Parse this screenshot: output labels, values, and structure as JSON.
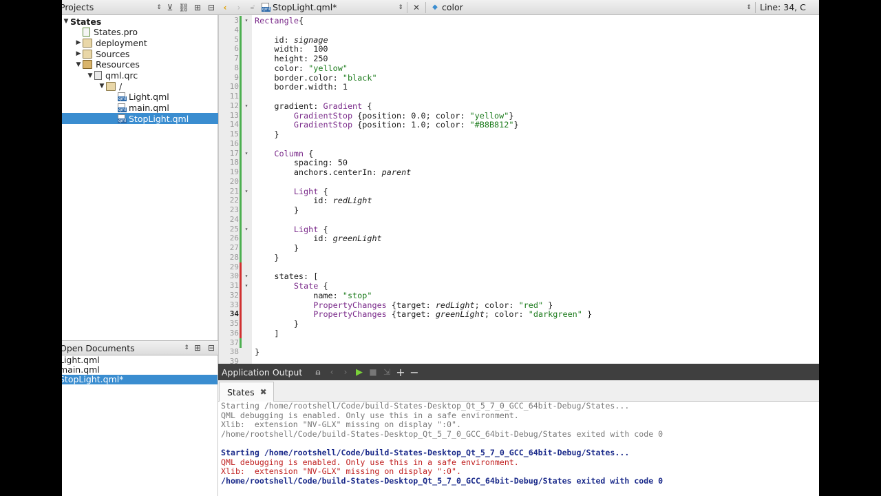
{
  "projects_panel": {
    "title": "Projects",
    "tree": [
      {
        "label": "States",
        "indent": 0,
        "arrow": "▼",
        "icon": "project-icon",
        "bold": true
      },
      {
        "label": "States.pro",
        "indent": 1,
        "arrow": "",
        "icon": "pro-file-icon"
      },
      {
        "label": "deployment",
        "indent": 1,
        "arrow": "▶",
        "icon": "folder-icon"
      },
      {
        "label": "Sources",
        "indent": 1,
        "arrow": "▶",
        "icon": "folder-icon"
      },
      {
        "label": "Resources",
        "indent": 1,
        "arrow": "▼",
        "icon": "resources-folder-icon"
      },
      {
        "label": "qml.qrc",
        "indent": 2,
        "arrow": "▼",
        "icon": "qrc-file-icon"
      },
      {
        "label": "/",
        "indent": 3,
        "arrow": "▼",
        "icon": "folder-icon"
      },
      {
        "label": "Light.qml",
        "indent": 4,
        "arrow": "",
        "icon": "qml-file-icon"
      },
      {
        "label": "main.qml",
        "indent": 4,
        "arrow": "",
        "icon": "qml-file-icon"
      },
      {
        "label": "StopLight.qml",
        "indent": 4,
        "arrow": "",
        "icon": "qml-file-icon",
        "selected": true
      }
    ]
  },
  "open_documents": {
    "title": "Open Documents",
    "items": [
      {
        "label": "Light.qml"
      },
      {
        "label": "main.qml"
      },
      {
        "label": "StopLight.qml*",
        "selected": true
      }
    ]
  },
  "editor_toolbar": {
    "file_name": "StopLight.qml*",
    "symbol": "color",
    "position": "Line: 34, C"
  },
  "code_lines": [
    {
      "n": "3",
      "fold": "▾",
      "tokens": [
        [
          "kw",
          "Rectangle"
        ],
        [
          "",
          "{"
        ]
      ]
    },
    {
      "n": "4",
      "tokens": []
    },
    {
      "n": "5",
      "tokens": [
        [
          "",
          "    id: "
        ],
        [
          "it",
          "signage"
        ]
      ]
    },
    {
      "n": "6",
      "tokens": [
        [
          "",
          "    width:  100"
        ]
      ]
    },
    {
      "n": "7",
      "tokens": [
        [
          "",
          "    height: 250"
        ]
      ]
    },
    {
      "n": "8",
      "tokens": [
        [
          "",
          "    color: "
        ],
        [
          "str",
          "\"yellow\""
        ]
      ]
    },
    {
      "n": "9",
      "tokens": [
        [
          "",
          "    border.color: "
        ],
        [
          "str",
          "\"black\""
        ]
      ]
    },
    {
      "n": "10",
      "tokens": [
        [
          "",
          "    border.width: 1"
        ]
      ]
    },
    {
      "n": "11",
      "tokens": []
    },
    {
      "n": "12",
      "fold": "▾",
      "tokens": [
        [
          "",
          "    gradient: "
        ],
        [
          "kw",
          "Gradient"
        ],
        [
          "",
          " {"
        ]
      ]
    },
    {
      "n": "13",
      "tokens": [
        [
          "",
          "        "
        ],
        [
          "kw",
          "GradientStop"
        ],
        [
          "",
          " {position: 0.0; color: "
        ],
        [
          "str",
          "\"yellow\""
        ],
        [
          "",
          "}"
        ]
      ]
    },
    {
      "n": "14",
      "tokens": [
        [
          "",
          "        "
        ],
        [
          "kw",
          "GradientStop"
        ],
        [
          "",
          " {position: 1.0; color: "
        ],
        [
          "str",
          "\"#B8B812\""
        ],
        [
          "",
          "}"
        ]
      ]
    },
    {
      "n": "15",
      "tokens": [
        [
          "",
          "    }"
        ]
      ]
    },
    {
      "n": "16",
      "tokens": []
    },
    {
      "n": "17",
      "fold": "▾",
      "tokens": [
        [
          "",
          "    "
        ],
        [
          "kw",
          "Column"
        ],
        [
          "",
          " {"
        ]
      ]
    },
    {
      "n": "18",
      "tokens": [
        [
          "",
          "        spacing: 50"
        ]
      ]
    },
    {
      "n": "19",
      "tokens": [
        [
          "",
          "        anchors.centerIn: "
        ],
        [
          "it",
          "parent"
        ]
      ]
    },
    {
      "n": "20",
      "tokens": []
    },
    {
      "n": "21",
      "fold": "▾",
      "tokens": [
        [
          "",
          "        "
        ],
        [
          "kw",
          "Light"
        ],
        [
          "",
          " {"
        ]
      ]
    },
    {
      "n": "22",
      "tokens": [
        [
          "",
          "            id: "
        ],
        [
          "it",
          "redLight"
        ]
      ]
    },
    {
      "n": "23",
      "tokens": [
        [
          "",
          "        }"
        ]
      ]
    },
    {
      "n": "24",
      "tokens": []
    },
    {
      "n": "25",
      "fold": "▾",
      "tokens": [
        [
          "",
          "        "
        ],
        [
          "kw",
          "Light"
        ],
        [
          "",
          " {"
        ]
      ]
    },
    {
      "n": "26",
      "tokens": [
        [
          "",
          "            id: "
        ],
        [
          "it",
          "greenLight"
        ]
      ]
    },
    {
      "n": "27",
      "tokens": [
        [
          "",
          "        }"
        ]
      ]
    },
    {
      "n": "28",
      "tokens": [
        [
          "",
          "    }"
        ]
      ]
    },
    {
      "n": "29",
      "tokens": []
    },
    {
      "n": "30",
      "fold": "▾",
      "tokens": [
        [
          "",
          "    states: ["
        ]
      ]
    },
    {
      "n": "31",
      "fold": "▾",
      "tokens": [
        [
          "",
          "        "
        ],
        [
          "kw",
          "State"
        ],
        [
          "",
          " {"
        ]
      ]
    },
    {
      "n": "32",
      "tokens": [
        [
          "",
          "            name: "
        ],
        [
          "str",
          "\"stop\""
        ]
      ]
    },
    {
      "n": "33",
      "tokens": [
        [
          "",
          "            "
        ],
        [
          "kw",
          "PropertyChanges"
        ],
        [
          "",
          " {target: "
        ],
        [
          "it",
          "redLight"
        ],
        [
          "",
          "; color: "
        ],
        [
          "str",
          "\"red\""
        ],
        [
          "",
          " }"
        ]
      ]
    },
    {
      "n": "34",
      "current": true,
      "tokens": [
        [
          "",
          "            "
        ],
        [
          "kw",
          "PropertyChanges"
        ],
        [
          "",
          " {target: "
        ],
        [
          "it",
          "greenLight"
        ],
        [
          "",
          "; color: "
        ],
        [
          "str",
          "\"darkgreen\""
        ],
        [
          "",
          " }"
        ]
      ]
    },
    {
      "n": "35",
      "tokens": [
        [
          "",
          "        }"
        ]
      ]
    },
    {
      "n": "36",
      "tokens": [
        [
          "",
          "    ]"
        ]
      ]
    },
    {
      "n": "37",
      "tokens": []
    },
    {
      "n": "38",
      "tokens": [
        [
          "",
          "}"
        ]
      ]
    },
    {
      "n": "39",
      "tokens": []
    }
  ],
  "output_panel": {
    "title": "Application Output",
    "tab_label": "States",
    "lines": [
      {
        "style": "o-gray",
        "text": "Starting /home/rootshell/Code/build-States-Desktop_Qt_5_7_0_GCC_64bit-Debug/States..."
      },
      {
        "style": "o-gray",
        "text": "QML debugging is enabled. Only use this in a safe environment."
      },
      {
        "style": "o-gray",
        "text": "Xlib:  extension \"NV-GLX\" missing on display \":0\"."
      },
      {
        "style": "o-gray",
        "text": "/home/rootshell/Code/build-States-Desktop_Qt_5_7_0_GCC_64bit-Debug/States exited with code 0"
      },
      {
        "style": "",
        "text": ""
      },
      {
        "style": "o-blue",
        "text": "Starting /home/rootshell/Code/build-States-Desktop_Qt_5_7_0_GCC_64bit-Debug/States..."
      },
      {
        "style": "o-red",
        "text": "QML debugging is enabled. Only use this in a safe environment."
      },
      {
        "style": "o-red",
        "text": "Xlib:  extension \"NV-GLX\" missing on display \":0\"."
      },
      {
        "style": "o-blue",
        "text": "/home/rootshell/Code/build-States-Desktop_Qt_5_7_0_GCC_64bit-Debug/States exited with code 0"
      }
    ]
  },
  "colors": {
    "selection": "#3a8dd0",
    "keyword": "#7a2a8a",
    "string": "#1a7a1a",
    "change_green": "#4caf50",
    "change_red": "#d03030",
    "run_green": "#7bd13a"
  }
}
